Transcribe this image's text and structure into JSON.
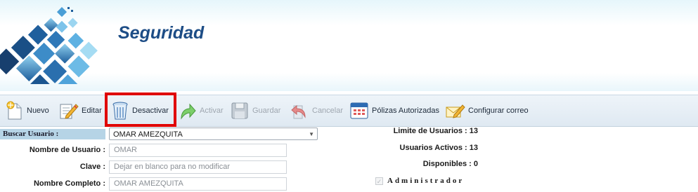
{
  "header": {
    "title": "Seguridad"
  },
  "toolbar": {
    "nuevo": "Nuevo",
    "editar": "Editar",
    "desactivar": "Desactivar",
    "activar": "Activar",
    "guardar": "Guardar",
    "cancelar": "Cancelar",
    "polizas": "Pólizas Autorizadas",
    "configurar": "Configurar correo"
  },
  "form": {
    "buscar_label": "Buscar Usuario :",
    "buscar_value": "OMAR AMEZQUITA",
    "nombre_usuario_label": "Nombre de Usuario :",
    "nombre_usuario_value": "OMAR",
    "clave_label": "Clave :",
    "clave_placeholder": "Dejar en blanco para no modificar",
    "nombre_completo_label": "Nombre Completo :",
    "nombre_completo_value": "OMAR AMEZQUITA",
    "administrador_label": "Administrador"
  },
  "stats": {
    "limite": "Limite de Usuarios : 13",
    "activos": "Usuarios Activos : 13",
    "disponibles": "Disponibles : 0"
  },
  "colors": {
    "title": "#1d4d86",
    "highlight": "#e00000",
    "search_label_bg": "#b6d4e6"
  }
}
